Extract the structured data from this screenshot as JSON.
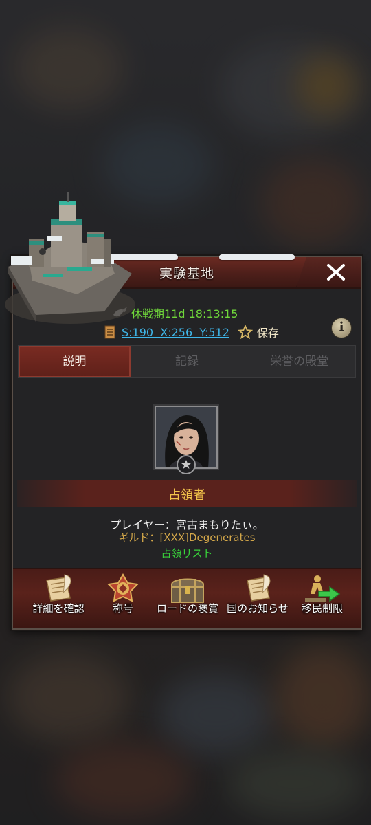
{
  "panel": {
    "title": "実験基地",
    "status": "休戦期11d 18:13:15",
    "coords": "S:190  X:256  Y:512",
    "save_label": "保存",
    "info_icon": "info-icon"
  },
  "tabs": [
    {
      "label": "説明",
      "active": true
    },
    {
      "label": "記録",
      "active": false
    },
    {
      "label": "栄誉の殿堂",
      "active": false
    }
  ],
  "occupant": {
    "heading": "占領者",
    "player_line": "プレイヤー：宮古まもりたぃ。",
    "guild_key": "ギルド：",
    "guild_value": "[XXX]Degenerates",
    "list_link": "占領リスト"
  },
  "actions": [
    {
      "label": "詳細を確認",
      "icon": "scroll-quill-icon"
    },
    {
      "label": "称号",
      "icon": "title-badge-icon"
    },
    {
      "label": "ロードの褒賞",
      "icon": "treasure-chest-icon"
    },
    {
      "label": "国のお知らせ",
      "icon": "notice-scroll-icon"
    },
    {
      "label": "移民制限",
      "icon": "migration-arrow-icon"
    }
  ],
  "colors": {
    "status_green": "#6fd63a",
    "coord_blue": "#3fb7ea",
    "occupant_gold": "#f1c24a",
    "tab_active": "#7a2b22"
  }
}
